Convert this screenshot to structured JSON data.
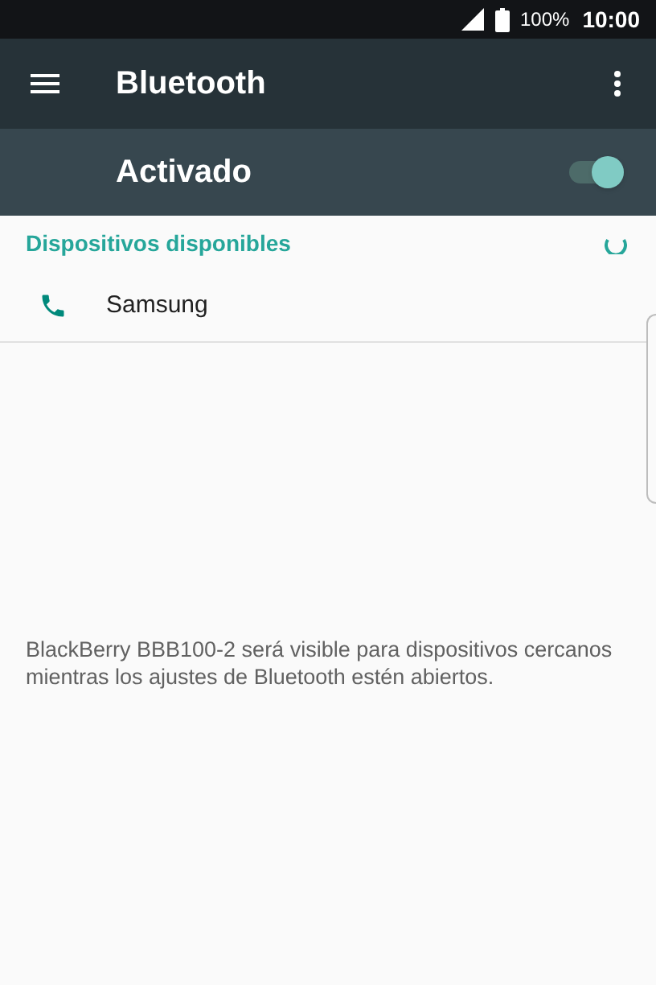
{
  "status_bar": {
    "battery": "100%",
    "time": "10:00"
  },
  "toolbar": {
    "title": "Bluetooth"
  },
  "master_switch": {
    "label": "Activado",
    "on": true
  },
  "section": {
    "title": "Dispositivos disponibles",
    "scanning": true
  },
  "devices": [
    {
      "name": "Samsung",
      "kind": "phone"
    }
  ],
  "footer_text": "BlackBerry BBB100-2 será visible para dispositivos cercanos mientras los ajustes de Bluetooth estén abiertos."
}
